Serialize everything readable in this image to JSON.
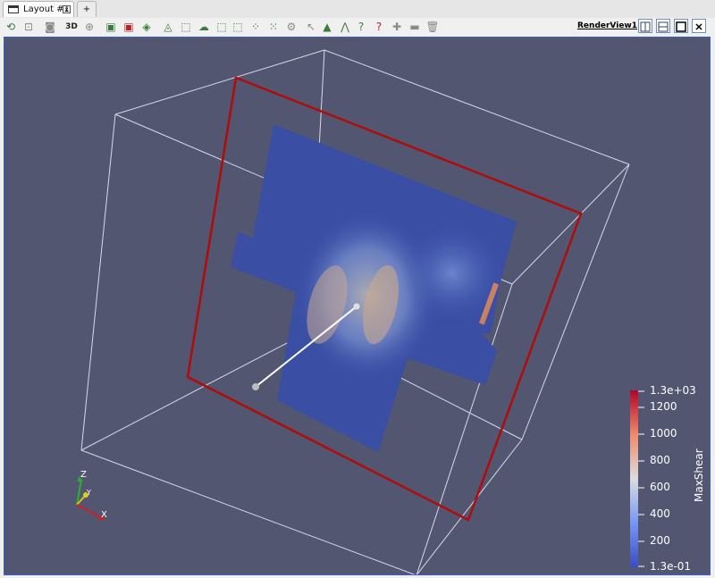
{
  "tabs": [
    {
      "label": "Layout #1",
      "close": "x"
    },
    {
      "label": "+"
    }
  ],
  "toolbar": {
    "mode_3d": "3D",
    "icons": [
      "reset-camera-icon",
      "zoom-to-data-icon",
      "capture-screenshot-icon",
      "toggle-3d-icon",
      "zoom-box-icon",
      "select-cells-on-icon",
      "select-points-on-icon",
      "select-cells-frustum-icon",
      "select-points-frustum-icon",
      "select-block-icon",
      "interactive-select-icon",
      "grow-selection-icon",
      "shrink-selection-icon",
      "clear-selection-icon",
      "edit-ruler-icon",
      "hover-points-icon",
      "hover-cells-icon",
      "find-data-icon",
      "add-icon",
      "remove-icon",
      "delete-icon"
    ]
  },
  "view": {
    "name": "RenderView1",
    "buttons": [
      "split-horizontal",
      "split-vertical",
      "maximize",
      "close"
    ]
  },
  "scene": {
    "background": "#525670",
    "outline_color": "#d8d8e8",
    "slice_outline_color": "#b00c0c"
  },
  "colorbar": {
    "title": "MaxShear",
    "labels": [
      "1.3e+03",
      "1200",
      "1000",
      "800",
      "600",
      "400",
      "200",
      "1.3e-01"
    ],
    "colors": [
      "#b40426",
      "#f08a6c",
      "#dcdddd",
      "#7597f6",
      "#3b4cc0"
    ]
  },
  "orientation_axes": {
    "x": "X",
    "y": "Y",
    "z": "Z"
  }
}
